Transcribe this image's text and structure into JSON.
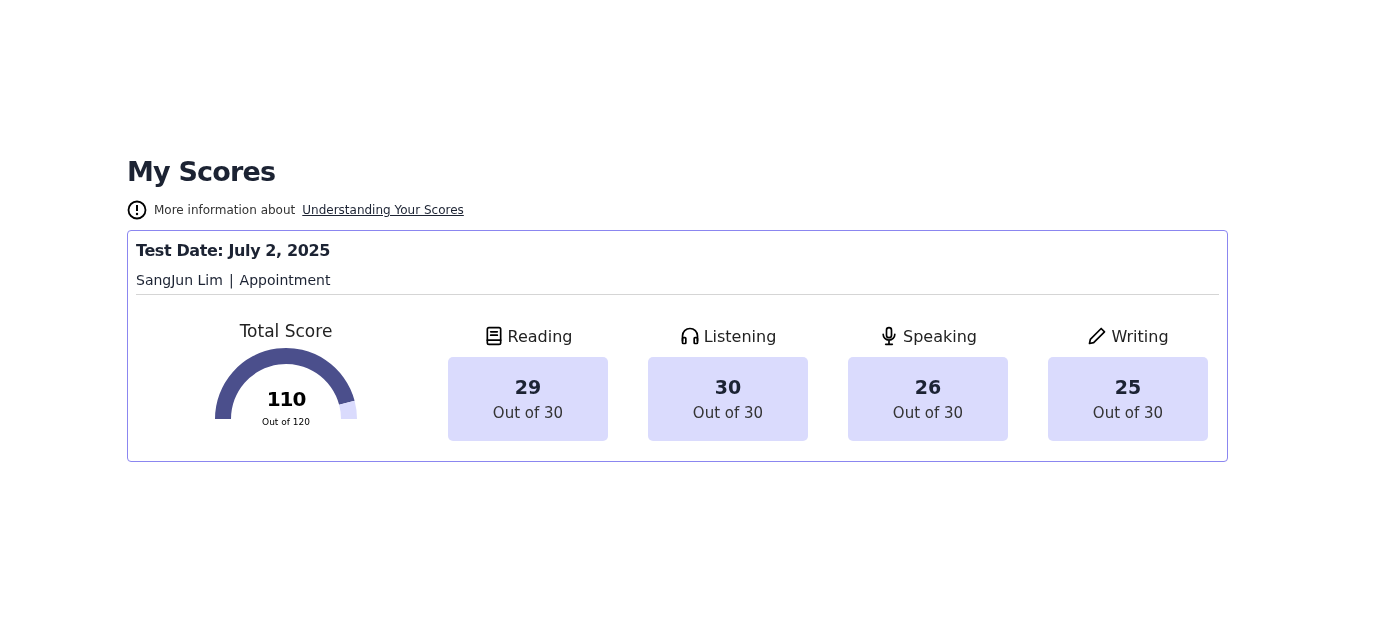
{
  "title": "My Scores",
  "info": {
    "text": "More information about",
    "link": "Understanding Your Scores"
  },
  "card": {
    "test_date": "Test Date: July 2, 2025",
    "name": "SangJun Lim",
    "separator": "|",
    "appointment": "Appointment",
    "total": {
      "label": "Total Score",
      "score": "110",
      "out_of": "Out of 120",
      "level": 0.917
    },
    "sections": [
      {
        "kind": "book",
        "label": "Reading",
        "score": "29",
        "out_of": "Out of 30"
      },
      {
        "kind": "headphones",
        "label": "Listening",
        "score": "30",
        "out_of": "Out of 30"
      },
      {
        "kind": "microphone",
        "label": "Speaking",
        "score": "26",
        "out_of": "Out of 30"
      },
      {
        "kind": "pencil",
        "label": "Writing",
        "score": "25",
        "out_of": "Out of 30"
      }
    ]
  }
}
